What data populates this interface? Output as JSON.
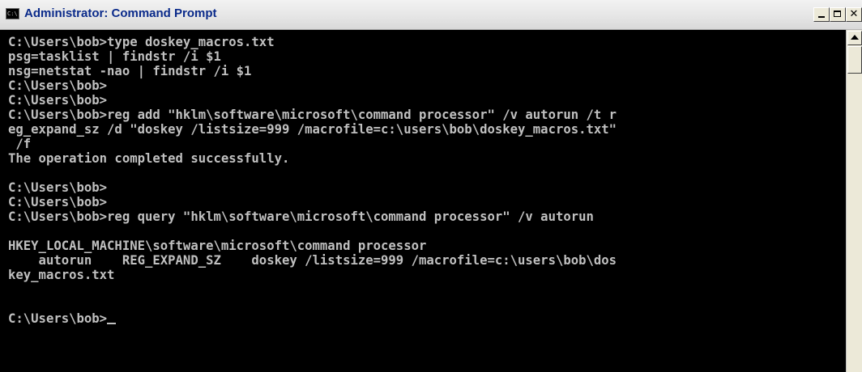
{
  "window": {
    "title": "Administrator: Command Prompt",
    "icon": "cmd-icon",
    "icon_text": "C:\\"
  },
  "console": {
    "lines": [
      "C:\\Users\\bob>type doskey_macros.txt",
      "psg=tasklist | findstr /i $1",
      "nsg=netstat -nao | findstr /i $1",
      "C:\\Users\\bob>",
      "C:\\Users\\bob>",
      "C:\\Users\\bob>reg add \"hklm\\software\\microsoft\\command processor\" /v autorun /t r",
      "eg_expand_sz /d \"doskey /listsize=999 /macrofile=c:\\users\\bob\\doskey_macros.txt\"",
      " /f",
      "The operation completed successfully.",
      "",
      "C:\\Users\\bob>",
      "C:\\Users\\bob>",
      "C:\\Users\\bob>reg query \"hklm\\software\\microsoft\\command processor\" /v autorun",
      "",
      "HKEY_LOCAL_MACHINE\\software\\microsoft\\command processor",
      "    autorun    REG_EXPAND_SZ    doskey /listsize=999 /macrofile=c:\\users\\bob\\dos",
      "key_macros.txt",
      "",
      "",
      "C:\\Users\\bob>"
    ]
  },
  "scrollbar": {
    "up_icon": "arrow-up-icon"
  },
  "colors": {
    "console_bg": "#000000",
    "console_text": "#c0c0c0",
    "title_text": "#0a2a8a"
  }
}
